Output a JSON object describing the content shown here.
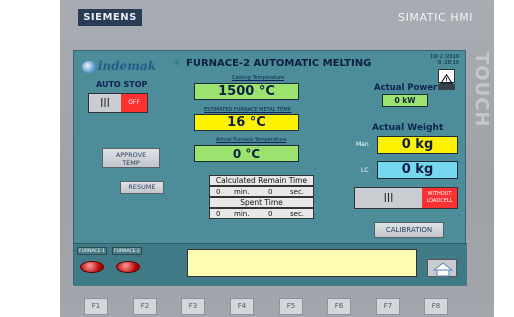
{
  "bezel": {
    "brand_left": "SIEMENS",
    "brand_right": "SIMATIC HMI",
    "side_word": "TOUCH"
  },
  "header": {
    "logo_text": "indemak",
    "logo_registered": "®",
    "title": "FURNACE-2 AUTOMATIC MELTING",
    "date": "19/ 2 /2019",
    "time": "8 :28:10"
  },
  "auto_stop": {
    "label": "AUTO STOP",
    "toggle_left": "|||",
    "toggle_right": "OFF"
  },
  "buttons": {
    "approve_line1": "APPROVE",
    "approve_line2": "TEMP",
    "resume": "RESUME",
    "without_line1": "WITHOUT",
    "without_line2": "LOADCELL",
    "calibration": "CALIBRATION",
    "lc_toggle_left": "|||"
  },
  "temperatures": {
    "casting_label": "Casting Temperature",
    "casting_value": "1500 °C",
    "estimated_label": "ESTIMATED FURNACE METAL TEMP.",
    "estimated_value": "16 °C",
    "actual_label": "Actual Furnace Temperature",
    "actual_value": "0 °C"
  },
  "remain_time": {
    "label": "Calculated Remain Time",
    "min_value": "0",
    "min_unit": "min.",
    "sec_value": "0",
    "sec_unit": "sec."
  },
  "spent_time": {
    "label": "Spent Time",
    "min_value": "0",
    "min_unit": "min.",
    "sec_value": "0",
    "sec_unit": "sec."
  },
  "power": {
    "label": "Actual Power",
    "value": "0 kW"
  },
  "weight": {
    "label": "Actual Weight",
    "man_label": "Man",
    "man_value": "0 kg",
    "lc_label": "LC",
    "lc_value": "0 kg"
  },
  "footer": {
    "furnace1": "FURNACE-1",
    "furnace2": "FURNACE-2"
  },
  "fkeys": [
    "F1",
    "F2",
    "F3",
    "F4",
    "F5",
    "F6",
    "F7",
    "F8"
  ]
}
